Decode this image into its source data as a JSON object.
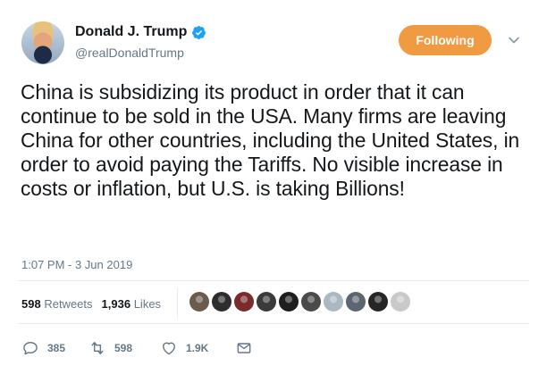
{
  "author": {
    "name": "Donald J. Trump",
    "handle": "@realDonaldTrump",
    "verified_icon": "verified-badge-icon"
  },
  "follow_button": {
    "label": "Following",
    "color": "#f09a41"
  },
  "tweet": {
    "text": "China is subsidizing its product in order that it can continue to be sold in the USA. Many firms are leaving China for other countries, including the United States, in order to avoid paying the Tariffs. No visible increase in costs or inflation, but U.S. is taking Billions!",
    "timestamp": "1:07 PM - 3 Jun 2019"
  },
  "stats": {
    "retweets_count": "598",
    "retweets_label": "Retweets",
    "likes_count": "1,936",
    "likes_label": "Likes"
  },
  "likers": [
    {
      "color": "#6b5b4b"
    },
    {
      "color": "#2d2d2d"
    },
    {
      "color": "#7a2b2b"
    },
    {
      "color": "#3b3b3b"
    },
    {
      "color": "#1e1e1e"
    },
    {
      "color": "#4a4a4a"
    },
    {
      "color": "#aab8c2"
    },
    {
      "color": "#5c6670"
    },
    {
      "color": "#262626"
    },
    {
      "color": "#c9c9c9"
    }
  ],
  "actions": {
    "reply_count": "385",
    "retweet_count": "598",
    "like_count": "1.9K"
  },
  "colors": {
    "accent": "#f09a41",
    "muted": "#657786",
    "text": "#14171a",
    "verified": "#1da1f2"
  }
}
